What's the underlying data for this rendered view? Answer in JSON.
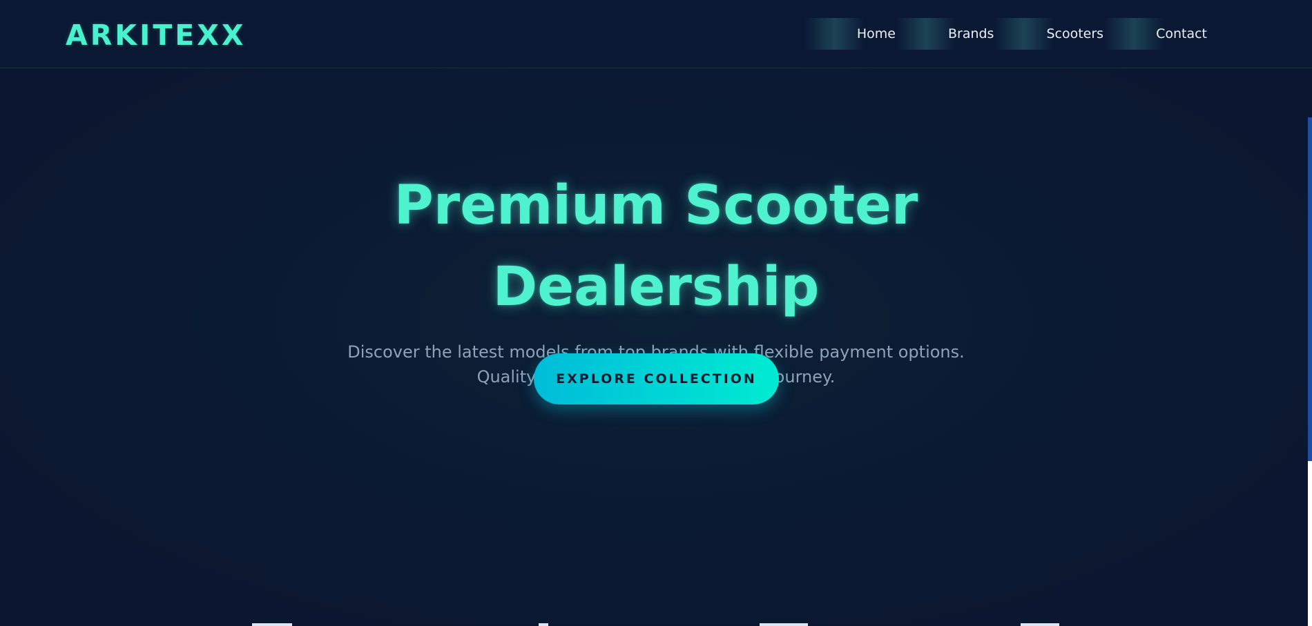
{
  "brand": {
    "logo_text": "ARKITEXX",
    "accent_color": "#49f2cf"
  },
  "nav": {
    "items": [
      {
        "label": "Home"
      },
      {
        "label": "Brands"
      },
      {
        "label": "Scooters"
      },
      {
        "label": "Contact"
      }
    ]
  },
  "hero": {
    "title": "Premium Scooter Dealership",
    "subtitle": "Discover the latest models from top brands with flexible payment options. Quality scooters for your everyday journey.",
    "cta_label": "EXPLORE COLLECTION",
    "cta_gradient": [
      "#00bcd9",
      "#00ebd2"
    ]
  },
  "colors": {
    "background": "#0b1730",
    "navbar": "#0a1833",
    "subtitle_text": "#8fa3b8",
    "nav_text": "#e8f1fb",
    "scrollbar_accent": "#1e4ea3"
  }
}
